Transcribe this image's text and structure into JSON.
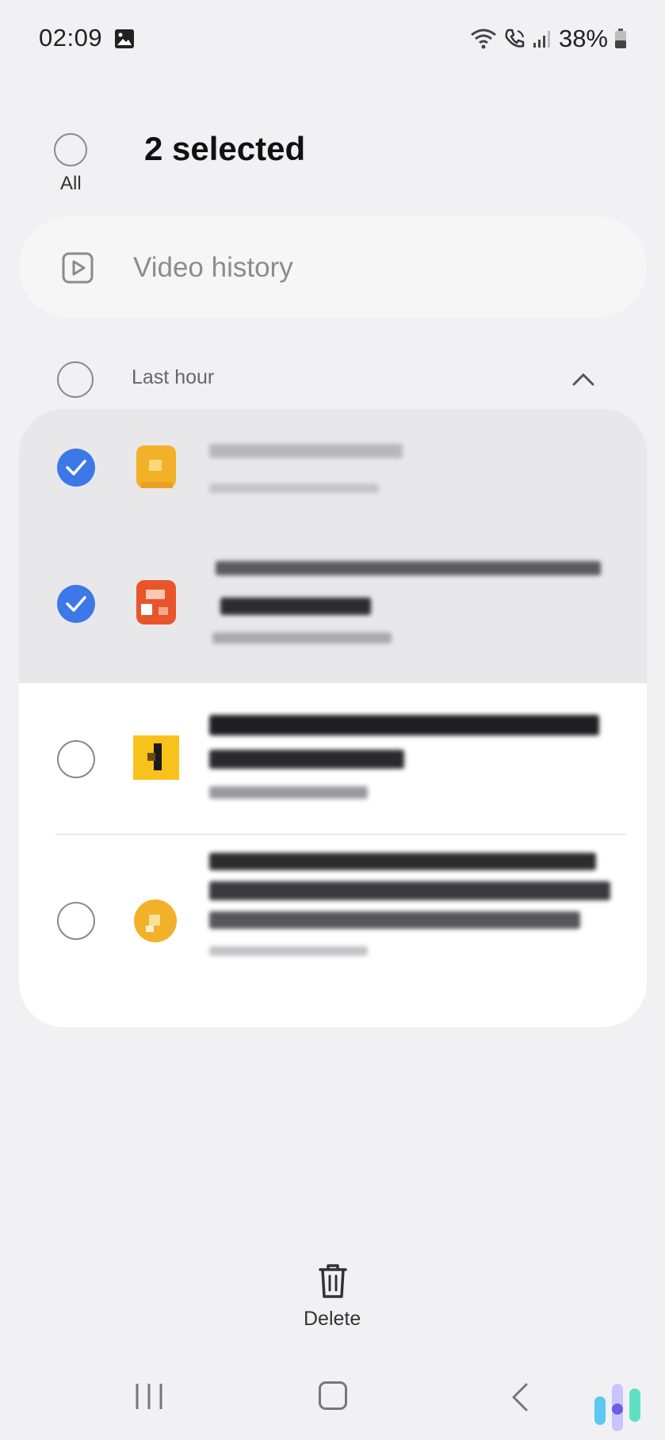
{
  "status_bar": {
    "time": "02:09",
    "battery": "38%",
    "icons": [
      "image-icon",
      "wifi-icon",
      "wifi-call-icon",
      "signal-icon",
      "battery-icon"
    ]
  },
  "header": {
    "selected_count": "2 selected",
    "select_all_label": "All"
  },
  "search": {
    "placeholder": "Video history",
    "icon": "video-history-icon"
  },
  "group": {
    "label": "Last hour",
    "expanded": true
  },
  "items": [
    {
      "selected": true,
      "title": "",
      "subtitle": "",
      "icon_color": "#f3b12a"
    },
    {
      "selected": true,
      "title": "",
      "subtitle": "",
      "icon_color": "#e8552a"
    },
    {
      "selected": false,
      "title": "",
      "subtitle": "",
      "icon_color": "#f7c21b"
    },
    {
      "selected": false,
      "title": "",
      "subtitle": "",
      "icon_color": "#f3b12a"
    }
  ],
  "actions": {
    "delete_label": "Delete"
  },
  "nav": [
    "recents-icon",
    "home-icon",
    "back-icon"
  ],
  "colors": {
    "accent": "#3d78e8",
    "background": "#f1f1f3",
    "selected_row": "#e8e8ea"
  }
}
